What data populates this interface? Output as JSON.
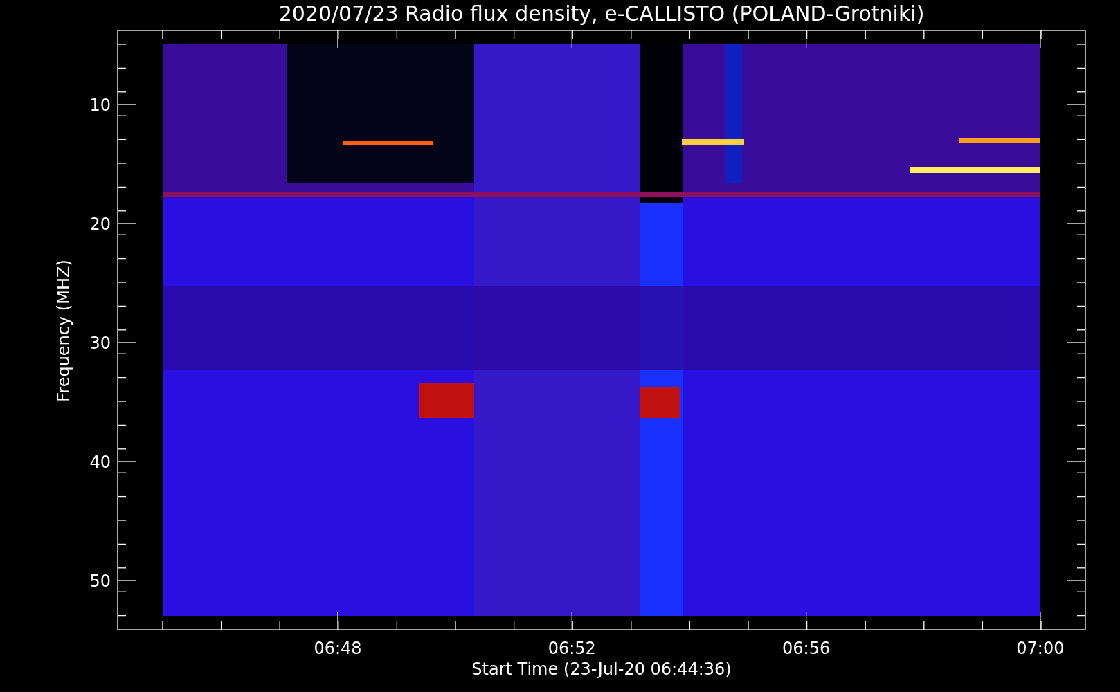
{
  "plot": {
    "title": "2020/07/23  Radio flux density, e-CALLISTO (POLAND-Grotniki)",
    "y_axis": {
      "label": "Frequency (MHZ)",
      "ticks": [
        "10",
        "20",
        "30",
        "40",
        "50"
      ]
    },
    "x_axis": {
      "label": "Start Time (23-Jul-20 06:44:36)",
      "ticks": [
        "06:48",
        "06:52",
        "06:56",
        "07:00"
      ]
    }
  }
}
